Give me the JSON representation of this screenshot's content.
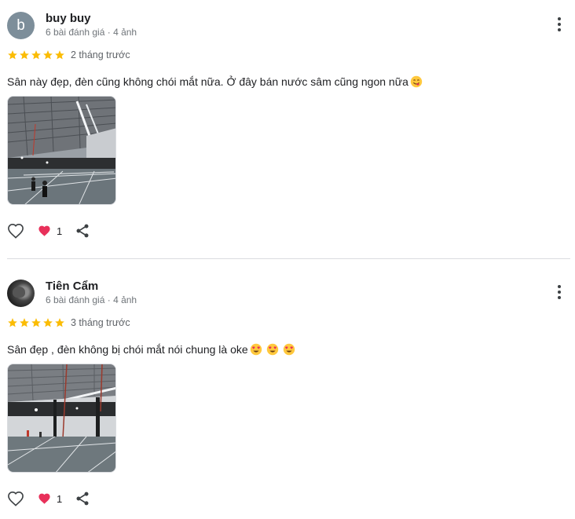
{
  "reviews": [
    {
      "avatar_letter": "b",
      "name": "buy buy",
      "meta": "6 bài đánh giá · 4 ảnh",
      "stars": 5,
      "time": "2 tháng trước",
      "text": "Sân này đẹp, đèn cũng không chói mắt nữa. Ở đây bán nước sâm cũng ngon nữa",
      "emojis": [
        "savoring-face-emoji"
      ],
      "reaction_count": "1"
    },
    {
      "avatar_letter": "",
      "name": "Tiên Cẩm",
      "meta": "6 bài đánh giá · 4 ảnh",
      "stars": 5,
      "time": "3 tháng trước",
      "text": "Sân đẹp , đèn không bị chói mắt nói chung là oke",
      "emojis": [
        "heart-eyes-emoji",
        "heart-eyes-emoji",
        "heart-eyes-emoji"
      ],
      "reaction_count": "1"
    }
  ],
  "colors": {
    "star": "#fbbc04",
    "reaction_heart": "#e8305a",
    "meta_text": "#70757a",
    "divider": "#dadce0"
  },
  "icons": [
    "heart-outline-icon",
    "heart-reaction-icon",
    "share-icon",
    "more-vert-icon",
    "star-icon"
  ]
}
